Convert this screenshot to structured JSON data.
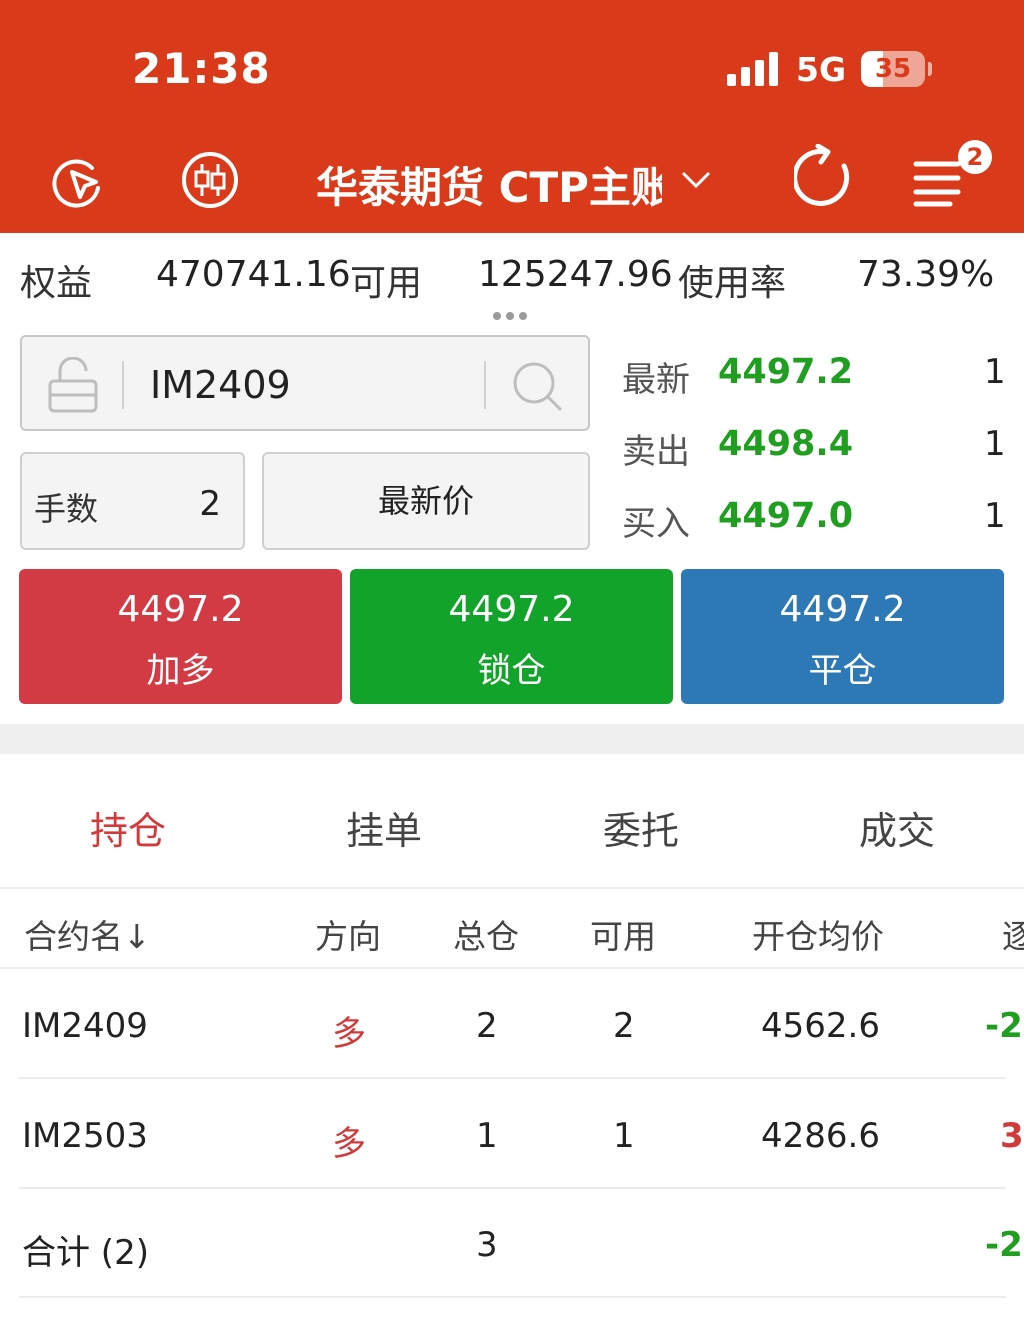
{
  "status_bar": {
    "time": "21:38",
    "network": "5G",
    "battery": "35",
    "battery_level": 0.35
  },
  "nav": {
    "title": "华泰期货 CTP主账户",
    "notification_count": "2",
    "icons": [
      "cursor-click-icon",
      "candlestick-icon",
      "chevron-down-icon",
      "refresh-icon",
      "menu-icon"
    ]
  },
  "account": {
    "equity_label": "权益",
    "equity_value": "470741.16",
    "available_label": "可用",
    "available_value": "125247.96",
    "usage_label": "使用率",
    "usage_value": "73.39%"
  },
  "order": {
    "contract": "IM2409",
    "lots_label": "手数",
    "lots_value": "2",
    "price_type": "最新价"
  },
  "quote": {
    "last_label": "最新",
    "last_price": "4497.2",
    "last_vol": "1",
    "ask_label": "卖出",
    "ask_price": "4498.4",
    "ask_vol": "1",
    "bid_label": "买入",
    "bid_price": "4497.0",
    "bid_vol": "1"
  },
  "actions": [
    {
      "price": "4497.2",
      "label": "加多",
      "color": "#d33b44"
    },
    {
      "price": "4497.2",
      "label": "锁仓",
      "color": "#12a32a"
    },
    {
      "price": "4497.2",
      "label": "平仓",
      "color": "#2d79b5"
    }
  ],
  "tabs": [
    "持仓",
    "挂单",
    "委托",
    "成交"
  ],
  "active_tab": "持仓",
  "positions": {
    "columns": [
      "合约名↓",
      "方向",
      "总仓",
      "可用",
      "开仓均价",
      "逐"
    ],
    "rows": [
      {
        "contract": "IM2409",
        "direction": "多",
        "total": "2",
        "available": "2",
        "avg_price": "4562.6",
        "pnl": "-2"
      },
      {
        "contract": "IM2503",
        "direction": "多",
        "total": "1",
        "available": "1",
        "avg_price": "4286.6",
        "pnl": "3"
      }
    ],
    "summary": {
      "label": "合计 (2)",
      "total": "3",
      "pnl": "-2:"
    }
  },
  "colors": {
    "brand": "#d93a1a",
    "up": "#d13a3a",
    "down": "#1f9e1f"
  }
}
